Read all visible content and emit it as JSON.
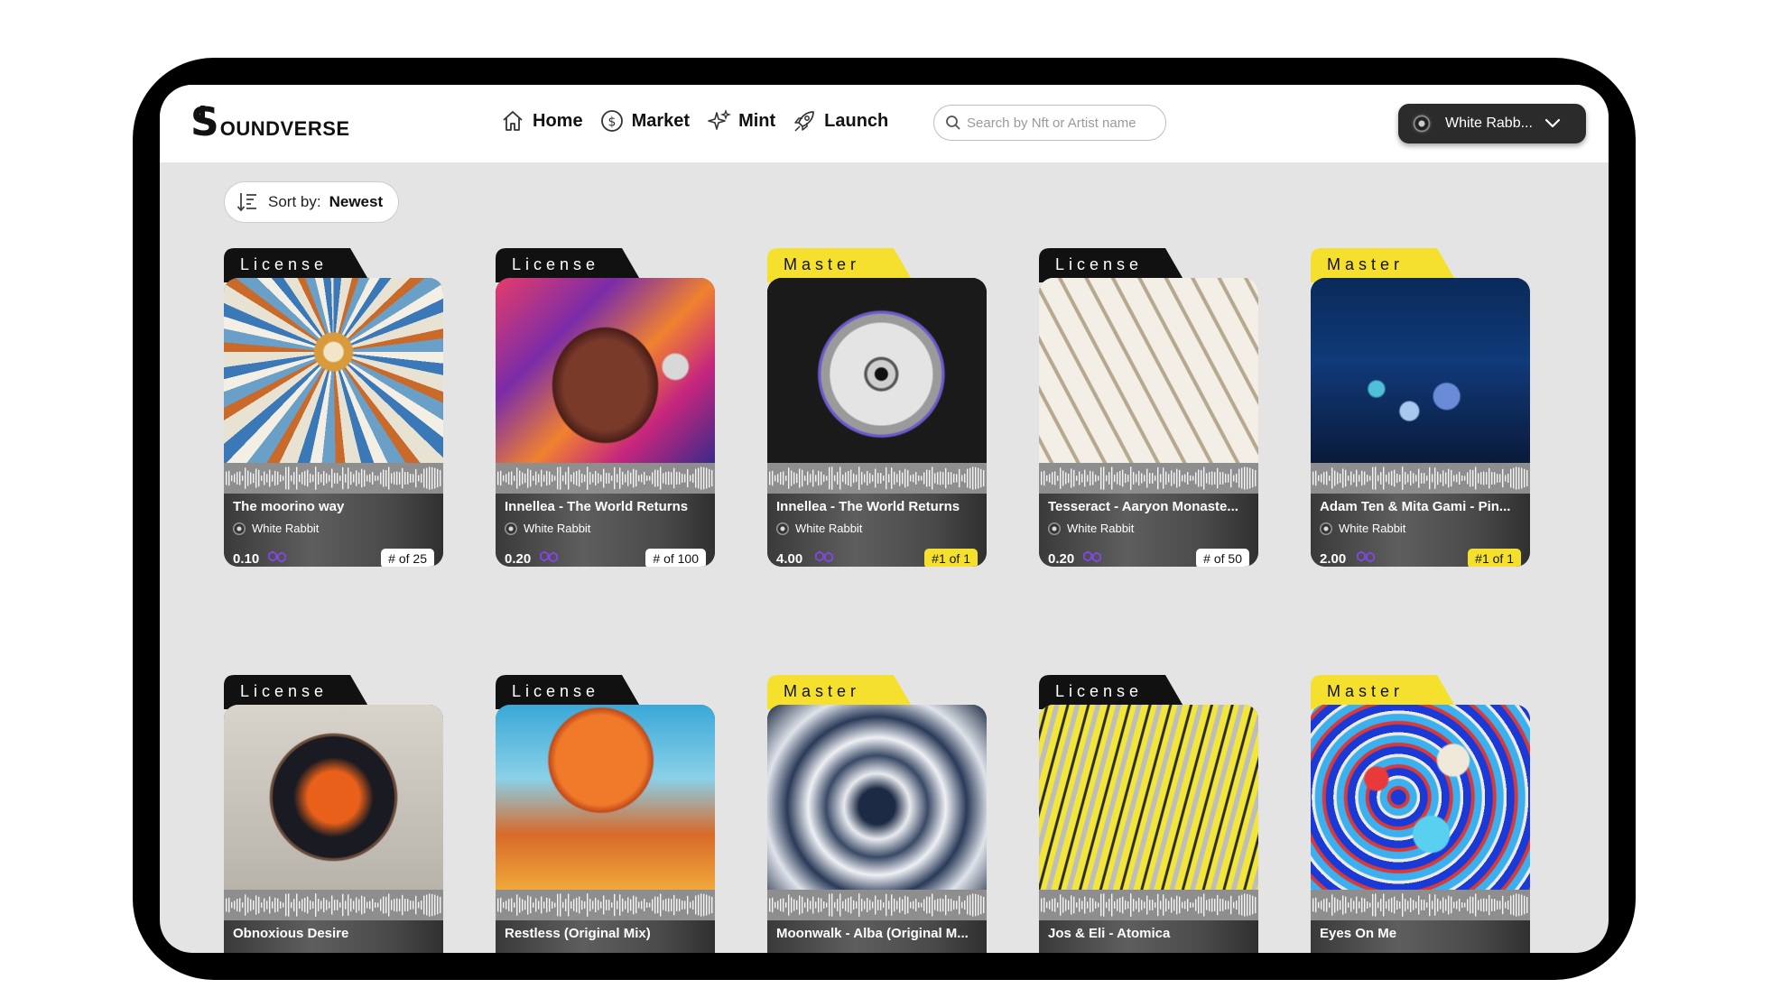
{
  "app": {
    "logo_letter": "S",
    "logo_text": "OUNDVERSE"
  },
  "nav": [
    {
      "icon": "home-icon",
      "label": "Home"
    },
    {
      "icon": "dollar-coin-icon",
      "label": "Market"
    },
    {
      "icon": "sparkles-icon",
      "label": "Mint"
    },
    {
      "icon": "rocket-icon",
      "label": "Launch"
    }
  ],
  "search": {
    "placeholder": "Search by Nft or Artist name",
    "value": ""
  },
  "user": {
    "name": "White Rabb..."
  },
  "sort": {
    "label": "Sort by:",
    "value": "Newest"
  },
  "colors": {
    "license_tab": "#111111",
    "master_tab": "#f5e12d",
    "chain": "#8247e5"
  },
  "cards": [
    {
      "type": "License",
      "title": "The moorino way",
      "artist": "White Rabbit",
      "price": "0.10",
      "edition": "# of 25"
    },
    {
      "type": "License",
      "title": "Innellea - The World Returns",
      "artist": "White Rabbit",
      "price": "0.20",
      "edition": "# of 100"
    },
    {
      "type": "Master",
      "title": "Innellea - The World Returns",
      "artist": "White Rabbit",
      "price": "4.00",
      "edition": "#1 of 1"
    },
    {
      "type": "License",
      "title": "Tesseract - Aaryon Monaste...",
      "artist": "White Rabbit",
      "price": "0.20",
      "edition": "# of 50"
    },
    {
      "type": "Master",
      "title": "Adam Ten & Mita Gami - Pin...",
      "artist": "White Rabbit",
      "price": "2.00",
      "edition": "#1 of 1"
    },
    {
      "type": "License",
      "title": "Obnoxious Desire"
    },
    {
      "type": "License",
      "title": "Restless (Original Mix)"
    },
    {
      "type": "Master",
      "title": "Moonwalk - Alba (Original M..."
    },
    {
      "type": "License",
      "title": "Jos & Eli - Atomica"
    },
    {
      "type": "Master",
      "title": "Eyes On Me"
    }
  ]
}
